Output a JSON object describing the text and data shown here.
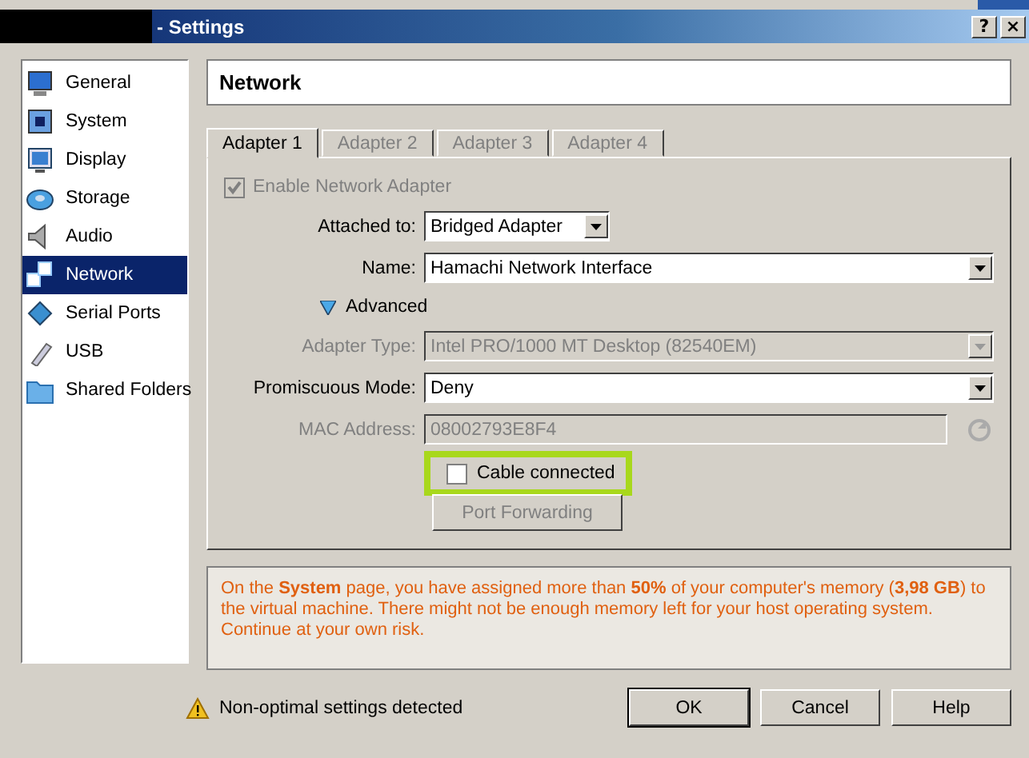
{
  "window": {
    "title": "- Settings",
    "help_glyph": "?",
    "close_glyph": "×"
  },
  "sidebar": {
    "items": [
      {
        "label": "General",
        "selected": false
      },
      {
        "label": "System",
        "selected": false
      },
      {
        "label": "Display",
        "selected": false
      },
      {
        "label": "Storage",
        "selected": false
      },
      {
        "label": "Audio",
        "selected": false
      },
      {
        "label": "Network",
        "selected": true
      },
      {
        "label": "Serial Ports",
        "selected": false
      },
      {
        "label": "USB",
        "selected": false
      },
      {
        "label": "Shared Folders",
        "selected": false
      }
    ]
  },
  "page_title": "Network",
  "tabs": [
    {
      "label": "Adapter 1",
      "selected": true
    },
    {
      "label": "Adapter 2",
      "selected": false
    },
    {
      "label": "Adapter 3",
      "selected": false
    },
    {
      "label": "Adapter 4",
      "selected": false
    }
  ],
  "enable_adapter": {
    "label": "Enable Network Adapter",
    "checked": true,
    "disabled": true
  },
  "fields": [
    {
      "kind": "combo",
      "label": "Attached to:",
      "value": "Bridged Adapter",
      "disabled": false
    },
    {
      "kind": "combo",
      "label": "Name:",
      "value": "Hamachi Network Interface",
      "disabled": false
    }
  ],
  "advanced": {
    "label": "Advanced",
    "expanded": true,
    "fields": [
      {
        "kind": "combo",
        "label": "Adapter Type:",
        "value": "Intel PRO/1000 MT Desktop (82540EM)",
        "disabled": true
      },
      {
        "kind": "combo",
        "label": "Promiscuous Mode:",
        "value": "Deny",
        "disabled": false
      },
      {
        "kind": "text",
        "label": "MAC Address:",
        "value": "08002793E8F4",
        "disabled": true
      }
    ]
  },
  "cable_connected": {
    "label": "Cable connected",
    "checked": false,
    "highlighted": true
  },
  "port_forwarding": {
    "label": "Port Forwarding",
    "disabled": true
  },
  "warning": "On the **System** page, you have assigned more than **50%** of your computer's memory (**3,98 GB**) to the virtual machine. There might not be enough memory left for your host operating system. Continue at your own risk.",
  "status": "Non-optimal settings detected",
  "buttons": [
    {
      "label": "OK",
      "default": true
    },
    {
      "label": "Cancel",
      "default": false
    },
    {
      "label": "Help",
      "default": false
    }
  ]
}
